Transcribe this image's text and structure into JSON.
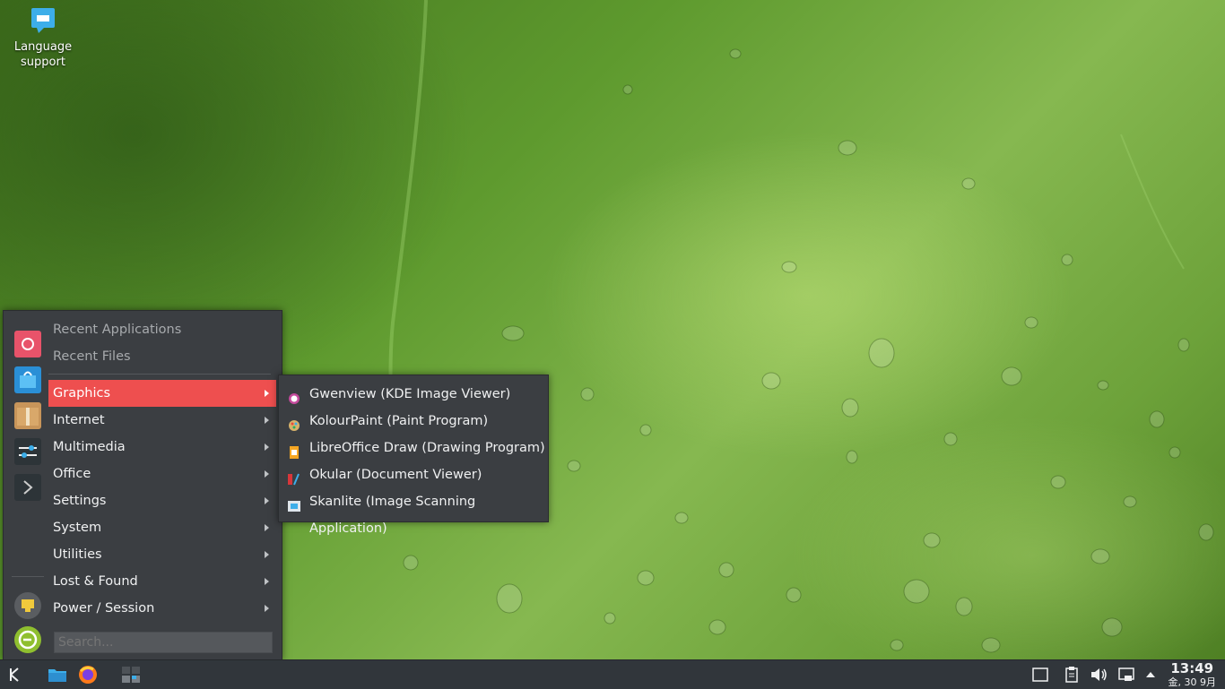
{
  "desktop": {
    "icons": [
      {
        "label": "Language support",
        "icon": "language-support-icon"
      }
    ]
  },
  "menu": {
    "top_items": [
      {
        "label": "Recent Applications"
      },
      {
        "label": "Recent Files"
      }
    ],
    "categories": [
      {
        "label": "Graphics",
        "active": true
      },
      {
        "label": "Internet"
      },
      {
        "label": "Multimedia"
      },
      {
        "label": "Office"
      },
      {
        "label": "Settings"
      },
      {
        "label": "System"
      },
      {
        "label": "Utilities"
      },
      {
        "label": "Lost & Found"
      },
      {
        "label": "Power / Session"
      }
    ],
    "search": {
      "placeholder": "Search..."
    },
    "favorites": [
      "debian-icon",
      "discover-store-icon",
      "package-icon",
      "system-settings-icon",
      "terminal-icon"
    ],
    "session": [
      "lock-screen-icon",
      "logout-icon"
    ],
    "accent_color": "#ee4f4f"
  },
  "submenu": {
    "items": [
      {
        "label": "Gwenview (KDE Image Viewer)",
        "icon": "gwenview-icon"
      },
      {
        "label": "KolourPaint (Paint Program)",
        "icon": "kolourpaint-icon"
      },
      {
        "label": "LibreOffice Draw (Drawing Program)",
        "icon": "libreoffice-draw-icon"
      },
      {
        "label": "Okular (Document Viewer)",
        "icon": "okular-icon"
      },
      {
        "label": "Skanlite (Image Scanning Application)",
        "icon": "skanlite-icon"
      }
    ]
  },
  "taskbar": {
    "launchers": [
      "kde-launcher-icon",
      "file-manager-icon",
      "firefox-icon",
      "pager-icon"
    ],
    "tray": [
      "show-desktop-icon",
      "clipboard-icon",
      "volume-icon",
      "network-icon",
      "tray-expand-icon"
    ],
    "clock": {
      "time": "13:49",
      "date": "金, 30 9月"
    }
  }
}
